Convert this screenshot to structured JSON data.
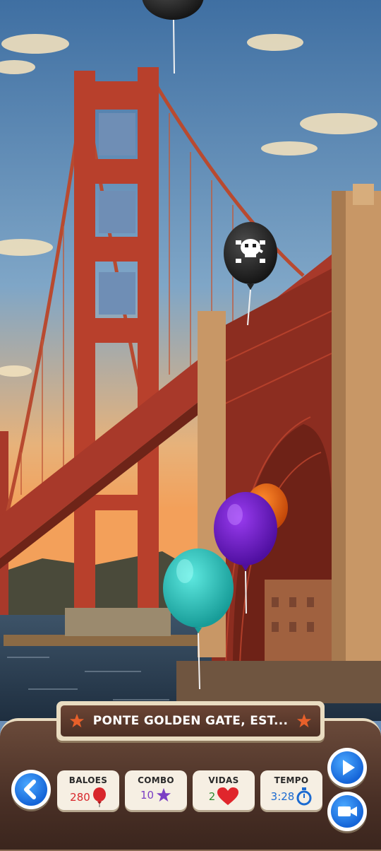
{
  "location": {
    "title": "PONTE GOLDEN GATE, EST..."
  },
  "stats": [
    {
      "label": "BALOES",
      "value": "280",
      "icon": "balloon-icon",
      "color": "#d8262b"
    },
    {
      "label": "COMBO",
      "value": "10",
      "icon": "star-icon",
      "color": "#7b3fc4"
    },
    {
      "label": "VIDAS",
      "value": "2",
      "icon": "heart-icon",
      "color": "#2f8a2f"
    },
    {
      "label": "TEMPO",
      "value": "3:28",
      "icon": "stopwatch-icon",
      "color": "#1c6bd1"
    }
  ],
  "colors": {
    "accent_blue": "#1c6bd1",
    "banner_star": "#e8602a",
    "bridge_red": "#b8402c"
  }
}
